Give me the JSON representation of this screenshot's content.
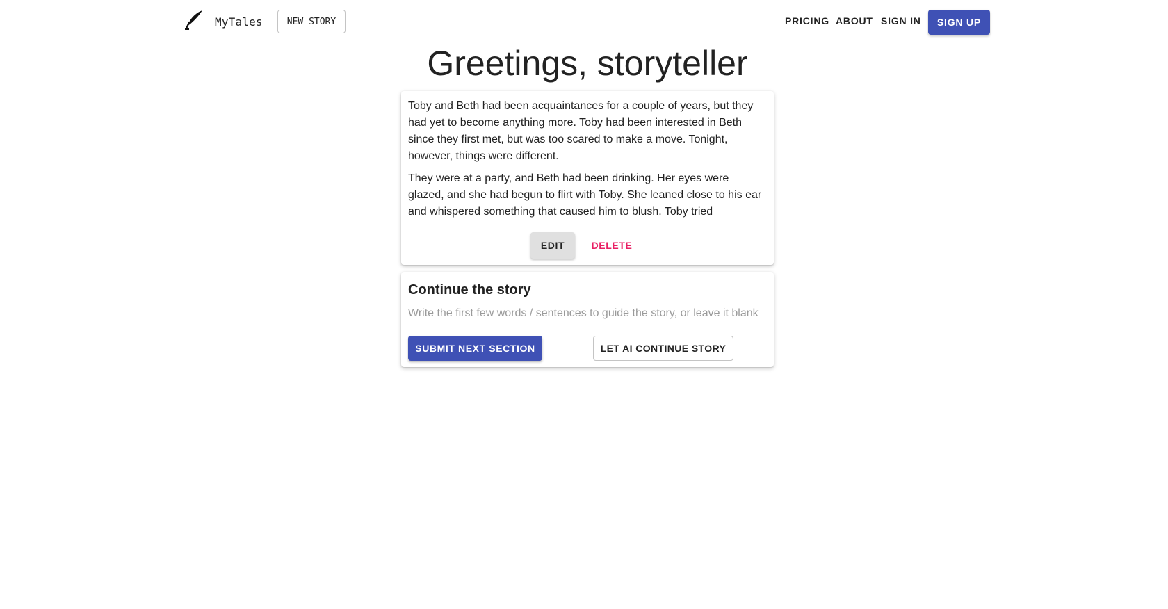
{
  "header": {
    "logo_icon": "feather-quill-icon",
    "app_name": "MyTales",
    "new_story_label": "NEW STORY",
    "nav": {
      "pricing": "PRICING",
      "about": "ABOUT",
      "sign_in": "SIGN IN",
      "sign_up": "SIGN UP"
    }
  },
  "main": {
    "title": "Greetings, storyteller",
    "story": {
      "paragraphs": [
        "Toby and Beth had been acquaintances for a couple of years, but they had yet to become anything more. Toby had been interested in Beth since they first met, but was too scared to make a move. Tonight, however, things were different.",
        "They were at a party, and Beth had been drinking. Her eyes were glazed, and she had begun to flirt with Toby. She leaned close to his ear and whispered something that caused him to blush. Toby tried"
      ],
      "edit_label": "EDIT",
      "delete_label": "DELETE"
    },
    "continue": {
      "title": "Continue the story",
      "input_value": "",
      "input_placeholder": "Write the first few words / sentences to guide the story, or leave it blank",
      "submit_label": "SUBMIT NEXT SECTION",
      "ai_label": "LET AI CONTINUE STORY"
    }
  },
  "colors": {
    "primary": "#3f51b5",
    "danger": "#e91e63",
    "secondary_button": "#e0e0e0"
  }
}
